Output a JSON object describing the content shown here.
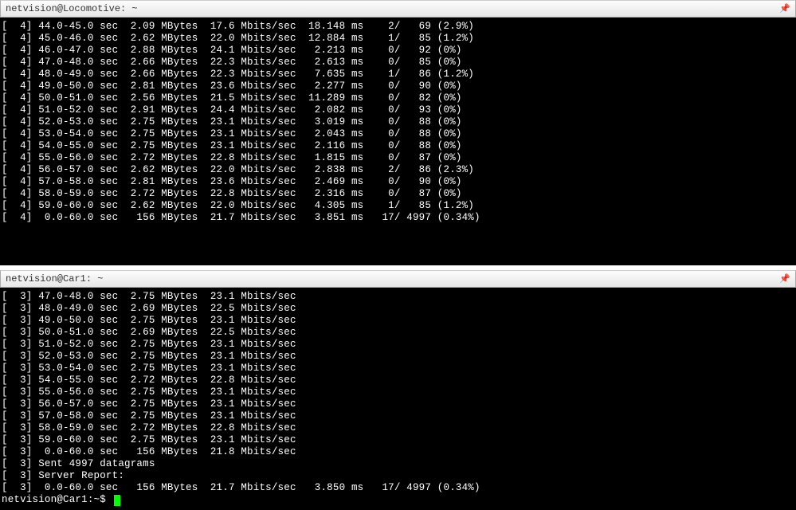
{
  "pane1": {
    "title": "netvision@Locomotive: ~",
    "rows": [
      {
        "id": "4",
        "t": "44.0-45.0",
        "u": "sec",
        "d": "2.09",
        "du": "MBytes",
        "b": "17.6",
        "bu": "Mbits/sec",
        "j": "18.148",
        "ju": "ms",
        "l": "2/",
        "tot": "69",
        "p": "(2.9%)"
      },
      {
        "id": "4",
        "t": "45.0-46.0",
        "u": "sec",
        "d": "2.62",
        "du": "MBytes",
        "b": "22.0",
        "bu": "Mbits/sec",
        "j": "12.884",
        "ju": "ms",
        "l": "1/",
        "tot": "85",
        "p": "(1.2%)"
      },
      {
        "id": "4",
        "t": "46.0-47.0",
        "u": "sec",
        "d": "2.88",
        "du": "MBytes",
        "b": "24.1",
        "bu": "Mbits/sec",
        "j": "2.213",
        "ju": "ms",
        "l": "0/",
        "tot": "92",
        "p": "(0%)"
      },
      {
        "id": "4",
        "t": "47.0-48.0",
        "u": "sec",
        "d": "2.66",
        "du": "MBytes",
        "b": "22.3",
        "bu": "Mbits/sec",
        "j": "2.613",
        "ju": "ms",
        "l": "0/",
        "tot": "85",
        "p": "(0%)"
      },
      {
        "id": "4",
        "t": "48.0-49.0",
        "u": "sec",
        "d": "2.66",
        "du": "MBytes",
        "b": "22.3",
        "bu": "Mbits/sec",
        "j": "7.635",
        "ju": "ms",
        "l": "1/",
        "tot": "86",
        "p": "(1.2%)"
      },
      {
        "id": "4",
        "t": "49.0-50.0",
        "u": "sec",
        "d": "2.81",
        "du": "MBytes",
        "b": "23.6",
        "bu": "Mbits/sec",
        "j": "2.277",
        "ju": "ms",
        "l": "0/",
        "tot": "90",
        "p": "(0%)"
      },
      {
        "id": "4",
        "t": "50.0-51.0",
        "u": "sec",
        "d": "2.56",
        "du": "MBytes",
        "b": "21.5",
        "bu": "Mbits/sec",
        "j": "11.289",
        "ju": "ms",
        "l": "0/",
        "tot": "82",
        "p": "(0%)"
      },
      {
        "id": "4",
        "t": "51.0-52.0",
        "u": "sec",
        "d": "2.91",
        "du": "MBytes",
        "b": "24.4",
        "bu": "Mbits/sec",
        "j": "2.082",
        "ju": "ms",
        "l": "0/",
        "tot": "93",
        "p": "(0%)"
      },
      {
        "id": "4",
        "t": "52.0-53.0",
        "u": "sec",
        "d": "2.75",
        "du": "MBytes",
        "b": "23.1",
        "bu": "Mbits/sec",
        "j": "3.019",
        "ju": "ms",
        "l": "0/",
        "tot": "88",
        "p": "(0%)"
      },
      {
        "id": "4",
        "t": "53.0-54.0",
        "u": "sec",
        "d": "2.75",
        "du": "MBytes",
        "b": "23.1",
        "bu": "Mbits/sec",
        "j": "2.043",
        "ju": "ms",
        "l": "0/",
        "tot": "88",
        "p": "(0%)"
      },
      {
        "id": "4",
        "t": "54.0-55.0",
        "u": "sec",
        "d": "2.75",
        "du": "MBytes",
        "b": "23.1",
        "bu": "Mbits/sec",
        "j": "2.116",
        "ju": "ms",
        "l": "0/",
        "tot": "88",
        "p": "(0%)"
      },
      {
        "id": "4",
        "t": "55.0-56.0",
        "u": "sec",
        "d": "2.72",
        "du": "MBytes",
        "b": "22.8",
        "bu": "Mbits/sec",
        "j": "1.815",
        "ju": "ms",
        "l": "0/",
        "tot": "87",
        "p": "(0%)"
      },
      {
        "id": "4",
        "t": "56.0-57.0",
        "u": "sec",
        "d": "2.62",
        "du": "MBytes",
        "b": "22.0",
        "bu": "Mbits/sec",
        "j": "2.838",
        "ju": "ms",
        "l": "2/",
        "tot": "86",
        "p": "(2.3%)"
      },
      {
        "id": "4",
        "t": "57.0-58.0",
        "u": "sec",
        "d": "2.81",
        "du": "MBytes",
        "b": "23.6",
        "bu": "Mbits/sec",
        "j": "2.469",
        "ju": "ms",
        "l": "0/",
        "tot": "90",
        "p": "(0%)"
      },
      {
        "id": "4",
        "t": "58.0-59.0",
        "u": "sec",
        "d": "2.72",
        "du": "MBytes",
        "b": "22.8",
        "bu": "Mbits/sec",
        "j": "2.316",
        "ju": "ms",
        "l": "0/",
        "tot": "87",
        "p": "(0%)"
      },
      {
        "id": "4",
        "t": "59.0-60.0",
        "u": "sec",
        "d": "2.62",
        "du": "MBytes",
        "b": "22.0",
        "bu": "Mbits/sec",
        "j": "4.305",
        "ju": "ms",
        "l": "1/",
        "tot": "85",
        "p": "(1.2%)"
      },
      {
        "id": "4",
        "t": "0.0-60.0",
        "u": "sec",
        "d": "156",
        "du": "MBytes",
        "b": "21.7",
        "bu": "Mbits/sec",
        "j": "3.851",
        "ju": "ms",
        "l": "17/",
        "tot": "4997",
        "p": "(0.34%)",
        "sum": true
      }
    ]
  },
  "pane2": {
    "title": "netvision@Car1: ~",
    "rows": [
      {
        "id": "3",
        "t": "47.0-48.0",
        "u": "sec",
        "d": "2.75",
        "du": "MBytes",
        "b": "23.1",
        "bu": "Mbits/sec"
      },
      {
        "id": "3",
        "t": "48.0-49.0",
        "u": "sec",
        "d": "2.69",
        "du": "MBytes",
        "b": "22.5",
        "bu": "Mbits/sec"
      },
      {
        "id": "3",
        "t": "49.0-50.0",
        "u": "sec",
        "d": "2.75",
        "du": "MBytes",
        "b": "23.1",
        "bu": "Mbits/sec"
      },
      {
        "id": "3",
        "t": "50.0-51.0",
        "u": "sec",
        "d": "2.69",
        "du": "MBytes",
        "b": "22.5",
        "bu": "Mbits/sec"
      },
      {
        "id": "3",
        "t": "51.0-52.0",
        "u": "sec",
        "d": "2.75",
        "du": "MBytes",
        "b": "23.1",
        "bu": "Mbits/sec"
      },
      {
        "id": "3",
        "t": "52.0-53.0",
        "u": "sec",
        "d": "2.75",
        "du": "MBytes",
        "b": "23.1",
        "bu": "Mbits/sec"
      },
      {
        "id": "3",
        "t": "53.0-54.0",
        "u": "sec",
        "d": "2.75",
        "du": "MBytes",
        "b": "23.1",
        "bu": "Mbits/sec"
      },
      {
        "id": "3",
        "t": "54.0-55.0",
        "u": "sec",
        "d": "2.72",
        "du": "MBytes",
        "b": "22.8",
        "bu": "Mbits/sec"
      },
      {
        "id": "3",
        "t": "55.0-56.0",
        "u": "sec",
        "d": "2.75",
        "du": "MBytes",
        "b": "23.1",
        "bu": "Mbits/sec"
      },
      {
        "id": "3",
        "t": "56.0-57.0",
        "u": "sec",
        "d": "2.75",
        "du": "MBytes",
        "b": "23.1",
        "bu": "Mbits/sec"
      },
      {
        "id": "3",
        "t": "57.0-58.0",
        "u": "sec",
        "d": "2.75",
        "du": "MBytes",
        "b": "23.1",
        "bu": "Mbits/sec"
      },
      {
        "id": "3",
        "t": "58.0-59.0",
        "u": "sec",
        "d": "2.72",
        "du": "MBytes",
        "b": "22.8",
        "bu": "Mbits/sec"
      },
      {
        "id": "3",
        "t": "59.0-60.0",
        "u": "sec",
        "d": "2.75",
        "du": "MBytes",
        "b": "23.1",
        "bu": "Mbits/sec"
      },
      {
        "id": "3",
        "t": "0.0-60.0",
        "u": "sec",
        "d": "156",
        "du": "MBytes",
        "b": "21.8",
        "bu": "Mbits/sec",
        "sum": true
      }
    ],
    "sent": "[  3] Sent 4997 datagrams",
    "srv": "[  3] Server Report:",
    "final": {
      "id": "3",
      "t": "0.0-60.0",
      "u": "sec",
      "d": "156",
      "du": "MBytes",
      "b": "21.7",
      "bu": "Mbits/sec",
      "j": "3.850",
      "ju": "ms",
      "l": "17/",
      "tot": "4997",
      "p": "(0.34%)",
      "sum": true
    },
    "prompt": "netvision@Car1:~$ "
  }
}
